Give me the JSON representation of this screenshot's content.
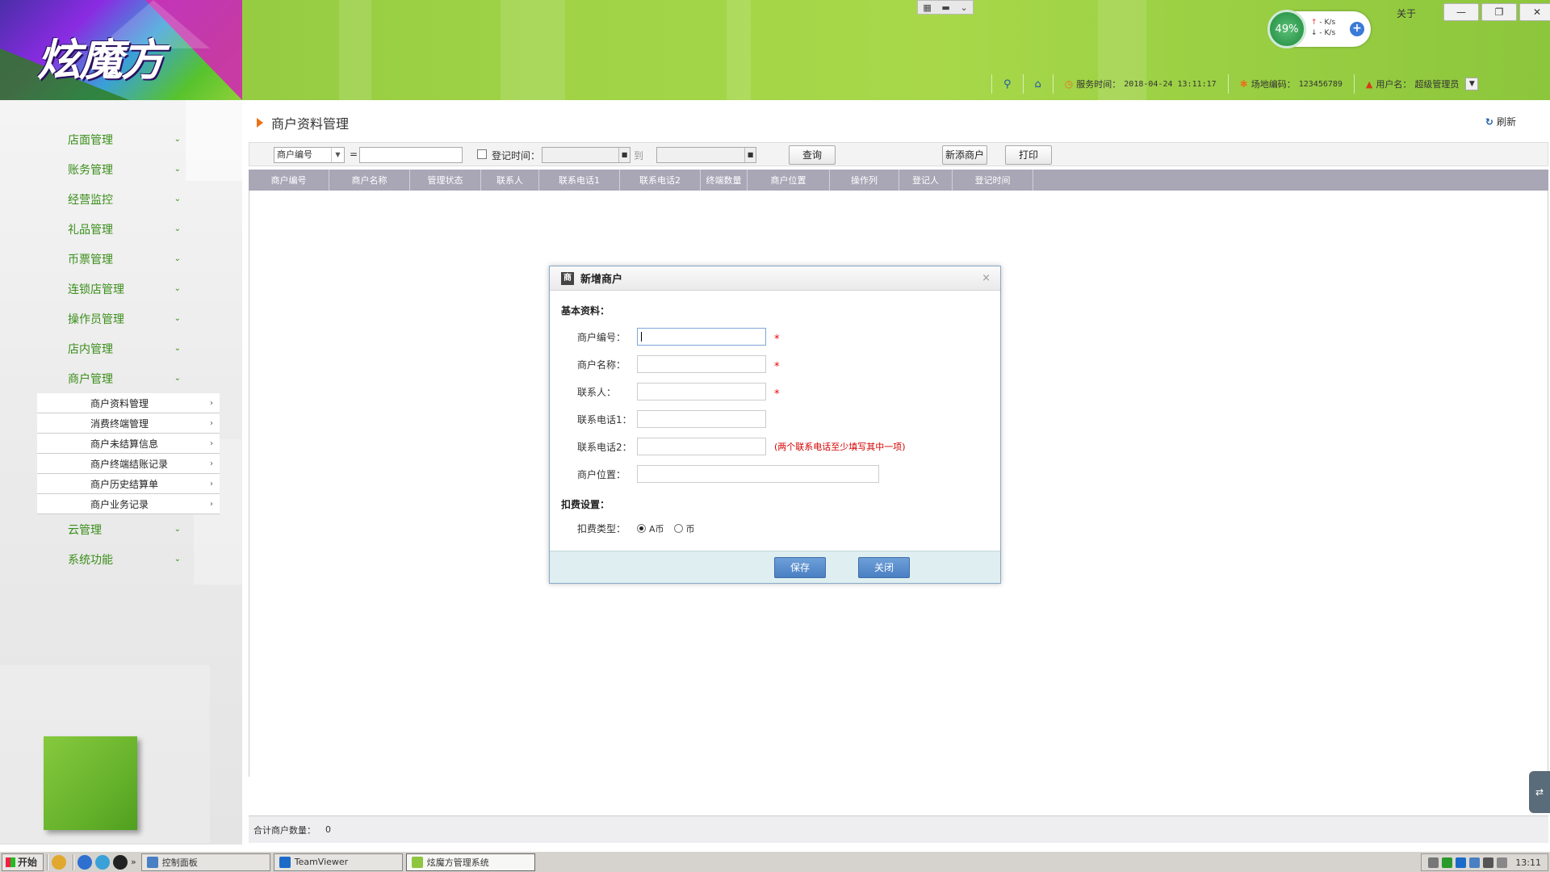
{
  "header": {
    "logo_text": "炫魔方",
    "about_label": "关于",
    "window_buttons": {
      "minimize": "—",
      "restore": "❐",
      "close": "✕"
    },
    "speed": {
      "percent": "49%",
      "up": "- K/s",
      "down": "- K/s",
      "plus": "+"
    },
    "status": {
      "server_time_label": "服务时间：",
      "server_time": "2018-04-24 13:11:17",
      "site_code_label": "场地编码：",
      "site_code": "123456789",
      "user_label": "用户名：",
      "user": "超级管理员"
    }
  },
  "sidebar": {
    "items": [
      {
        "label": "店面管理"
      },
      {
        "label": "账务管理"
      },
      {
        "label": "经营监控"
      },
      {
        "label": "礼品管理"
      },
      {
        "label": "币票管理"
      },
      {
        "label": "连锁店管理"
      },
      {
        "label": "操作员管理"
      },
      {
        "label": "店内管理"
      },
      {
        "label": "商户管理"
      },
      {
        "label": "云管理"
      },
      {
        "label": "系统功能"
      }
    ],
    "submenu": [
      {
        "label": "商户资料管理"
      },
      {
        "label": "消费终端管理"
      },
      {
        "label": "商户未结算信息"
      },
      {
        "label": "商户终端结账记录"
      },
      {
        "label": "商户历史结算单"
      },
      {
        "label": "商户业务记录"
      }
    ]
  },
  "main": {
    "title": "商户资料管理",
    "refresh_label": "刷新",
    "toolbar": {
      "field_select": "商户编号",
      "eq": "=",
      "reg_time_label": "登记时间：",
      "to_label": "到",
      "query_button": "查询",
      "add_button": "新添商户",
      "print_button": "打印"
    },
    "columns": [
      "商户编号",
      "商户名称",
      "管理状态",
      "联系人",
      "联系电话1",
      "联系电话2",
      "终端数量",
      "商户位置",
      "操作列",
      "登记人",
      "登记时间"
    ],
    "footer": {
      "total_label": "合计商户数量：",
      "total": "0"
    }
  },
  "dialog": {
    "title": "新增商户",
    "close": "×",
    "section_basic": "基本资料：",
    "fields": {
      "merchant_no": "商户编号：",
      "merchant_name": "商户名称：",
      "contact": "联系人：",
      "phone1": "联系电话1：",
      "phone2": "联系电话2：",
      "location": "商户位置："
    },
    "required_mark": "*",
    "phone_hint": "(两个联系电话至少填写其中一项)",
    "section_fee": "扣费设置：",
    "fee_type_label": "扣费类型：",
    "fee_options": [
      "A币",
      "币"
    ],
    "fee_selected": "A币",
    "save_button": "保存",
    "close_button": "关闭"
  },
  "taskbar": {
    "start": "开始",
    "tasks": [
      {
        "label": "控制面板"
      },
      {
        "label": "TeamViewer"
      },
      {
        "label": "炫魔方管理系统"
      }
    ],
    "clock": "13:11"
  },
  "colors": {
    "header_green": "#9fd346",
    "menu_green": "#3a8e1a",
    "grid_header": "#a9a6b6",
    "button_blue": "#4a7fc3",
    "required_red": "#e00000"
  }
}
